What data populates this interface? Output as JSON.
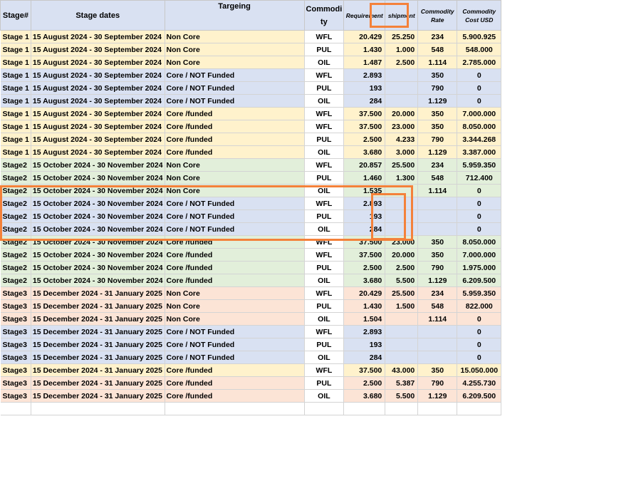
{
  "headers": {
    "stage": "Stage#",
    "dates": "Stage dates",
    "targeting": "Targeing",
    "commodity": "Commodi ty",
    "requirement": "Requirement",
    "shipment": "shipment",
    "rate": "Commodity Rate",
    "cost": "Commodity Cost USD"
  },
  "rows": [
    {
      "stage": "Stage 1",
      "dates": "15 August 2024 - 30 September 2024",
      "target": "Non Core",
      "commodity": "WFL",
      "requirement": "20.429",
      "shipment": "25.250",
      "rate": "234",
      "cost": "5.900.925",
      "color": "y"
    },
    {
      "stage": "Stage 1",
      "dates": "15 August 2024 - 30 September 2024",
      "target": "Non Core",
      "commodity": "PUL",
      "requirement": "1.430",
      "shipment": "1.000",
      "rate": "548",
      "cost": "548.000",
      "color": "y"
    },
    {
      "stage": "Stage 1",
      "dates": "15 August 2024 - 30 September 2024",
      "target": "Non Core",
      "commodity": "OIL",
      "requirement": "1.487",
      "shipment": "2.500",
      "rate": "1.114",
      "cost": "2.785.000",
      "color": "y"
    },
    {
      "stage": "Stage 1",
      "dates": "15 August 2024 - 30 September 2024",
      "target": "Core / NOT Funded",
      "commodity": "WFL",
      "requirement": "2.893",
      "shipment": "",
      "rate": "350",
      "cost": "0",
      "color": "b"
    },
    {
      "stage": "Stage 1",
      "dates": "15 August 2024 - 30 September 2024",
      "target": "Core / NOT Funded",
      "commodity": "PUL",
      "requirement": "193",
      "shipment": "",
      "rate": "790",
      "cost": "0",
      "color": "b"
    },
    {
      "stage": "Stage 1",
      "dates": "15 August 2024 - 30 September 2024",
      "target": "Core / NOT Funded",
      "commodity": "OIL",
      "requirement": "284",
      "shipment": "",
      "rate": "1.129",
      "cost": "0",
      "color": "b"
    },
    {
      "stage": "Stage 1",
      "dates": "15 August 2024 - 30 September 2024",
      "target": "Core /funded",
      "commodity": "WFL",
      "requirement": "37.500",
      "shipment": "20.000",
      "rate": "350",
      "cost": "7.000.000",
      "color": "y"
    },
    {
      "stage": "Stage 1",
      "dates": "15 August 2024 - 30 September 2024",
      "target": "Core /funded",
      "commodity": "WFL",
      "requirement": "37.500",
      "shipment": "23.000",
      "rate": "350",
      "cost": "8.050.000",
      "color": "y"
    },
    {
      "stage": "Stage 1",
      "dates": "15 August 2024 - 30 September 2024",
      "target": "Core /funded",
      "commodity": "PUL",
      "requirement": "2.500",
      "shipment": "4.233",
      "rate": "790",
      "cost": "3.344.268",
      "color": "y"
    },
    {
      "stage": "Stage 1",
      "dates": "15 August 2024 - 30 September 2024",
      "target": "Core /funded",
      "commodity": "OIL",
      "requirement": "3.680",
      "shipment": "3.000",
      "rate": "1.129",
      "cost": "3.387.000",
      "color": "y"
    },
    {
      "stage": "Stage2",
      "dates": "15 October 2024 - 30 November 2024",
      "target": "Non Core",
      "commodity": "WFL",
      "requirement": "20.857",
      "shipment": "25.500",
      "rate": "234",
      "cost": "5.959.350",
      "color": "g"
    },
    {
      "stage": "Stage2",
      "dates": "15 October 2024 - 30 November 2024",
      "target": "Non Core",
      "commodity": "PUL",
      "requirement": "1.460",
      "shipment": "1.300",
      "rate": "548",
      "cost": "712.400",
      "color": "g"
    },
    {
      "stage": "Stage2",
      "dates": "15 October 2024 - 30 November 2024",
      "target": "Non Core",
      "commodity": "OIL",
      "requirement": "1.535",
      "shipment": "",
      "rate": "1.114",
      "cost": "0",
      "color": "g"
    },
    {
      "stage": "Stage2",
      "dates": "15 October 2024 - 30 November 2024",
      "target": "Core / NOT Funded",
      "commodity": "WFL",
      "requirement": "2.893",
      "shipment": "",
      "rate": "",
      "cost": "0",
      "color": "b"
    },
    {
      "stage": "Stage2",
      "dates": "15 October 2024 - 30 November 2024",
      "target": "Core / NOT Funded",
      "commodity": "PUL",
      "requirement": "193",
      "shipment": "",
      "rate": "",
      "cost": "0",
      "color": "b"
    },
    {
      "stage": "Stage2",
      "dates": "15 October 2024 - 30 November 2024",
      "target": "Core / NOT Funded",
      "commodity": "OIL",
      "requirement": "284",
      "shipment": "",
      "rate": "",
      "cost": "0",
      "color": "b"
    },
    {
      "stage": "Stage2",
      "dates": "15 October 2024 - 30 November 2024",
      "target": "Core /funded",
      "commodity": "WFL",
      "requirement": "37.500",
      "shipment": "23.000",
      "rate": "350",
      "cost": "8.050.000",
      "color": "g"
    },
    {
      "stage": "Stage2",
      "dates": "15 October 2024 - 30 November 2024",
      "target": "Core /funded",
      "commodity": "WFL",
      "requirement": "37.500",
      "shipment": "20.000",
      "rate": "350",
      "cost": "7.000.000",
      "color": "g"
    },
    {
      "stage": "Stage2",
      "dates": "15 October 2024 - 30 November 2024",
      "target": "Core /funded",
      "commodity": "PUL",
      "requirement": "2.500",
      "shipment": "2.500",
      "rate": "790",
      "cost": "1.975.000",
      "color": "g"
    },
    {
      "stage": "Stage2",
      "dates": "15 October 2024 - 30 November 2024",
      "target": "Core /funded",
      "commodity": "OIL",
      "requirement": "3.680",
      "shipment": "5.500",
      "rate": "1.129",
      "cost": "6.209.500",
      "color": "g"
    },
    {
      "stage": "Stage3",
      "dates": "15 December 2024 - 31 January 2025",
      "target": "Non Core",
      "commodity": "WFL",
      "requirement": "20.429",
      "shipment": "25.500",
      "rate": "234",
      "cost": "5.959.350",
      "color": "p"
    },
    {
      "stage": "Stage3",
      "dates": "15 December 2024 - 31 January 2025",
      "target": "Non Core",
      "commodity": "PUL",
      "requirement": "1.430",
      "shipment": "1.500",
      "rate": "548",
      "cost": "822.000",
      "color": "p"
    },
    {
      "stage": "Stage3",
      "dates": "15 December 2024 - 31 January 2025",
      "target": "Non Core",
      "commodity": "OIL",
      "requirement": "1.504",
      "shipment": "",
      "rate": "1.114",
      "cost": "0",
      "color": "p"
    },
    {
      "stage": "Stage3",
      "dates": "15 December 2024 - 31 January 2025",
      "target": "Core / NOT Funded",
      "commodity": "WFL",
      "requirement": "2.893",
      "shipment": "",
      "rate": "",
      "cost": "0",
      "color": "b"
    },
    {
      "stage": "Stage3",
      "dates": "15 December 2024 - 31 January 2025",
      "target": "Core / NOT Funded",
      "commodity": "PUL",
      "requirement": "193",
      "shipment": "",
      "rate": "",
      "cost": "0",
      "color": "b"
    },
    {
      "stage": "Stage3",
      "dates": "15 December 2024 - 31 January 2025",
      "target": "Core / NOT Funded",
      "commodity": "OIL",
      "requirement": "284",
      "shipment": "",
      "rate": "",
      "cost": "0",
      "color": "b"
    },
    {
      "stage": "Stage3",
      "dates": "15 December 2024 - 31 January 2025",
      "target": "Core /funded",
      "commodity": "WFL",
      "requirement": "37.500",
      "shipment": "43.000",
      "rate": "350",
      "cost": "15.050.000",
      "color": "y"
    },
    {
      "stage": "Stage3",
      "dates": "15 December 2024 - 31 January 2025",
      "target": "Core /funded",
      "commodity": "PUL",
      "requirement": "2.500",
      "shipment": "5.387",
      "rate": "790",
      "cost": "4.255.730",
      "color": "p"
    },
    {
      "stage": "Stage3",
      "dates": "15 December 2024 - 31 January 2025",
      "target": "Core /funded",
      "commodity": "OIL",
      "requirement": "3.680",
      "shipment": "5.500",
      "rate": "1.129",
      "cost": "6.209.500",
      "color": "p"
    }
  ],
  "colors": {
    "highlight": "#f4813a",
    "header": "#d9e1f2",
    "yellow": "#fff2cc",
    "green": "#e2efda",
    "blue": "#d9e1f2",
    "pink": "#fce4d6"
  }
}
